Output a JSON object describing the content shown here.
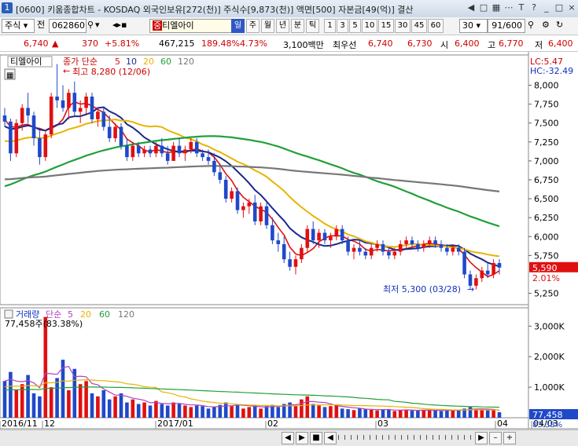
{
  "window": {
    "title": "[0600] 키움종합차트 - KOSDAQ 외국인보유[272(천)] 주식수[9,873(천)] 액면[500] 자본금[49(억)] 결산"
  },
  "toolbar": {
    "market": "주식",
    "period_label": "전",
    "code": "062860",
    "stock_name": "티엘아이",
    "period_buttons": [
      "일",
      "주",
      "월",
      "년",
      "분",
      "틱"
    ],
    "active_period": "일",
    "minute_buttons": [
      "1",
      "3",
      "5",
      "10",
      "15",
      "30",
      "45",
      "60"
    ],
    "interval_value": "30",
    "count": "91",
    "count_total": "/600"
  },
  "quote": {
    "price": "6,740",
    "arrow": "▲",
    "change": "370",
    "change_pct": "+5.81%",
    "volume": "467,215",
    "volume_ratio": "189.48%",
    "turnover": "4.73%",
    "amount": "3,100백만",
    "best_ask_label": "최우선",
    "best_ask": "6,740",
    "best_bid": "6,730",
    "open_label": "시",
    "open": "6,400",
    "high_label": "고",
    "high": "6,770",
    "low_label": "저",
    "low": "6,400"
  },
  "legend": {
    "name": "티엘아이",
    "ma_label": "종가 단순",
    "ma_periods": [
      "5",
      "10",
      "20",
      "60",
      "120"
    ],
    "lc": "LC:5.47",
    "hc": "HC:-32.49",
    "max_note": "최고 8,280 (12/06)",
    "min_note": "최저 5,300 (03/28)",
    "last_price": "5,590",
    "last_pct": "2.01%"
  },
  "volume_legend": {
    "label": "거래량",
    "ma_label": "단순",
    "ma_periods": [
      "5",
      "20",
      "60",
      "120"
    ],
    "max_note": "77,458주(83.38%)",
    "last_volume": "77,458",
    "last_pct": "83.38%"
  },
  "colors": {
    "up": "#e01010",
    "down": "#1f49c8",
    "ma5": "#e01010",
    "ma10": "#1a2a8c",
    "ma20": "#e8b400",
    "ma60": "#22a03a",
    "ma120": "#777777",
    "vol_ma5": "#b040c0"
  },
  "chart_data": {
    "type": "candlestick",
    "price_axis": [
      "8,000",
      "7,750",
      "7,500",
      "7,250",
      "7,000",
      "6,750",
      "6,500",
      "6,250",
      "6,000",
      "5,750",
      "5,250"
    ],
    "price_range": [
      5100,
      8400
    ],
    "volume_axis": [
      "3,000K",
      "2,000K",
      "1,000K"
    ],
    "volume_range": [
      0,
      3600000
    ],
    "date_axis": [
      "2016/11",
      "12",
      "2017/01",
      "02",
      "03",
      "04",
      "04/03"
    ],
    "ohlc": [
      [
        7600,
        7700,
        7450,
        7520
      ],
      [
        7520,
        7560,
        7000,
        7100
      ],
      [
        7100,
        7550,
        7050,
        7500
      ],
      [
        7500,
        7750,
        7400,
        7700
      ],
      [
        7700,
        7900,
        7500,
        7600
      ],
      [
        7600,
        7650,
        7200,
        7300
      ],
      [
        7300,
        7400,
        6950,
        7050
      ],
      [
        7050,
        7400,
        7000,
        7350
      ],
      [
        7350,
        7900,
        7300,
        7850
      ],
      [
        7850,
        8280,
        7700,
        7800
      ],
      [
        7800,
        8000,
        7650,
        7700
      ],
      [
        7700,
        7950,
        7550,
        7900
      ],
      [
        7900,
        8050,
        7600,
        7650
      ],
      [
        7650,
        7800,
        7500,
        7700
      ],
      [
        7700,
        7900,
        7600,
        7850
      ],
      [
        7850,
        7900,
        7500,
        7550
      ],
      [
        7550,
        7700,
        7450,
        7650
      ],
      [
        7650,
        7700,
        7400,
        7450
      ],
      [
        7450,
        7600,
        7250,
        7300
      ],
      [
        7300,
        7500,
        7250,
        7450
      ],
      [
        7450,
        7500,
        7150,
        7200
      ],
      [
        7200,
        7300,
        7000,
        7050
      ],
      [
        7050,
        7250,
        7000,
        7200
      ],
      [
        7200,
        7250,
        7050,
        7100
      ],
      [
        7100,
        7200,
        7050,
        7150
      ],
      [
        7150,
        7200,
        7050,
        7100
      ],
      [
        7100,
        7250,
        7050,
        7200
      ],
      [
        7200,
        7300,
        7050,
        7100
      ],
      [
        7100,
        7200,
        6950,
        7000
      ],
      [
        7000,
        7250,
        7000,
        7200
      ],
      [
        7200,
        7300,
        7050,
        7100
      ],
      [
        7100,
        7200,
        7000,
        7150
      ],
      [
        7150,
        7300,
        7100,
        7250
      ],
      [
        7250,
        7300,
        7050,
        7100
      ],
      [
        7100,
        7150,
        7000,
        7050
      ],
      [
        7050,
        7150,
        6950,
        7000
      ],
      [
        7000,
        7100,
        6800,
        6850
      ],
      [
        6850,
        6950,
        6700,
        6750
      ],
      [
        6750,
        6800,
        6450,
        6500
      ],
      [
        6500,
        6650,
        6450,
        6600
      ],
      [
        6600,
        6650,
        6300,
        6350
      ],
      [
        6350,
        6450,
        6250,
        6400
      ],
      [
        6400,
        6500,
        6300,
        6450
      ],
      [
        6450,
        6550,
        6150,
        6200
      ],
      [
        6200,
        6450,
        6150,
        6400
      ],
      [
        6400,
        6450,
        6100,
        6150
      ],
      [
        6150,
        6250,
        5900,
        5950
      ],
      [
        5950,
        6050,
        5800,
        5900
      ],
      [
        5900,
        6000,
        5650,
        5700
      ],
      [
        5700,
        5800,
        5550,
        5600
      ],
      [
        5600,
        5750,
        5500,
        5700
      ],
      [
        5700,
        5900,
        5650,
        5850
      ],
      [
        5850,
        6150,
        5800,
        6100
      ],
      [
        6100,
        6200,
        5900,
        5950
      ],
      [
        5950,
        6100,
        5850,
        6050
      ],
      [
        6050,
        6100,
        5900,
        5950
      ],
      [
        5950,
        6050,
        5850,
        6000
      ],
      [
        6000,
        6150,
        5950,
        6100
      ],
      [
        6100,
        6150,
        5900,
        5950
      ],
      [
        5950,
        6000,
        5750,
        5800
      ],
      [
        5800,
        5900,
        5700,
        5850
      ],
      [
        5850,
        5950,
        5750,
        5800
      ],
      [
        5800,
        5850,
        5700,
        5750
      ],
      [
        5750,
        5900,
        5700,
        5850
      ],
      [
        5850,
        5950,
        5800,
        5900
      ],
      [
        5900,
        5950,
        5750,
        5800
      ],
      [
        5800,
        5850,
        5700,
        5750
      ],
      [
        5750,
        5850,
        5700,
        5800
      ],
      [
        5800,
        5950,
        5750,
        5900
      ],
      [
        5900,
        6000,
        5850,
        5950
      ],
      [
        5950,
        6000,
        5850,
        5900
      ],
      [
        5900,
        5950,
        5800,
        5850
      ],
      [
        5850,
        5950,
        5800,
        5900
      ],
      [
        5900,
        6000,
        5850,
        5950
      ],
      [
        5950,
        6000,
        5850,
        5900
      ],
      [
        5900,
        5950,
        5800,
        5850
      ],
      [
        5850,
        5900,
        5750,
        5800
      ],
      [
        5800,
        5900,
        5750,
        5850
      ],
      [
        5850,
        5900,
        5750,
        5800
      ],
      [
        5800,
        5850,
        5450,
        5500
      ],
      [
        5500,
        5550,
        5300,
        5350
      ],
      [
        5350,
        5500,
        5300,
        5450
      ],
      [
        5450,
        5600,
        5400,
        5550
      ],
      [
        5550,
        5650,
        5450,
        5500
      ],
      [
        5500,
        5700,
        5450,
        5650
      ],
      [
        5650,
        5700,
        5500,
        5590
      ]
    ],
    "volume": [
      1200,
      1500,
      900,
      1100,
      1400,
      800,
      700,
      3300,
      1000,
      1300,
      1900,
      900,
      1600,
      1100,
      1200,
      800,
      700,
      900,
      600,
      700,
      800,
      500,
      600,
      450,
      500,
      400,
      550,
      450,
      400,
      500,
      450,
      400,
      350,
      400,
      380,
      300,
      350,
      420,
      500,
      380,
      450,
      300,
      350,
      400,
      300,
      380,
      420,
      350,
      450,
      500,
      400,
      600,
      700,
      450,
      400,
      350,
      380,
      420,
      300,
      280,
      250,
      300,
      280,
      260,
      240,
      260,
      280,
      220,
      250,
      270,
      240,
      230,
      250,
      260,
      240,
      220,
      230,
      250,
      260,
      300,
      350,
      280,
      260,
      240,
      250,
      180
    ]
  }
}
